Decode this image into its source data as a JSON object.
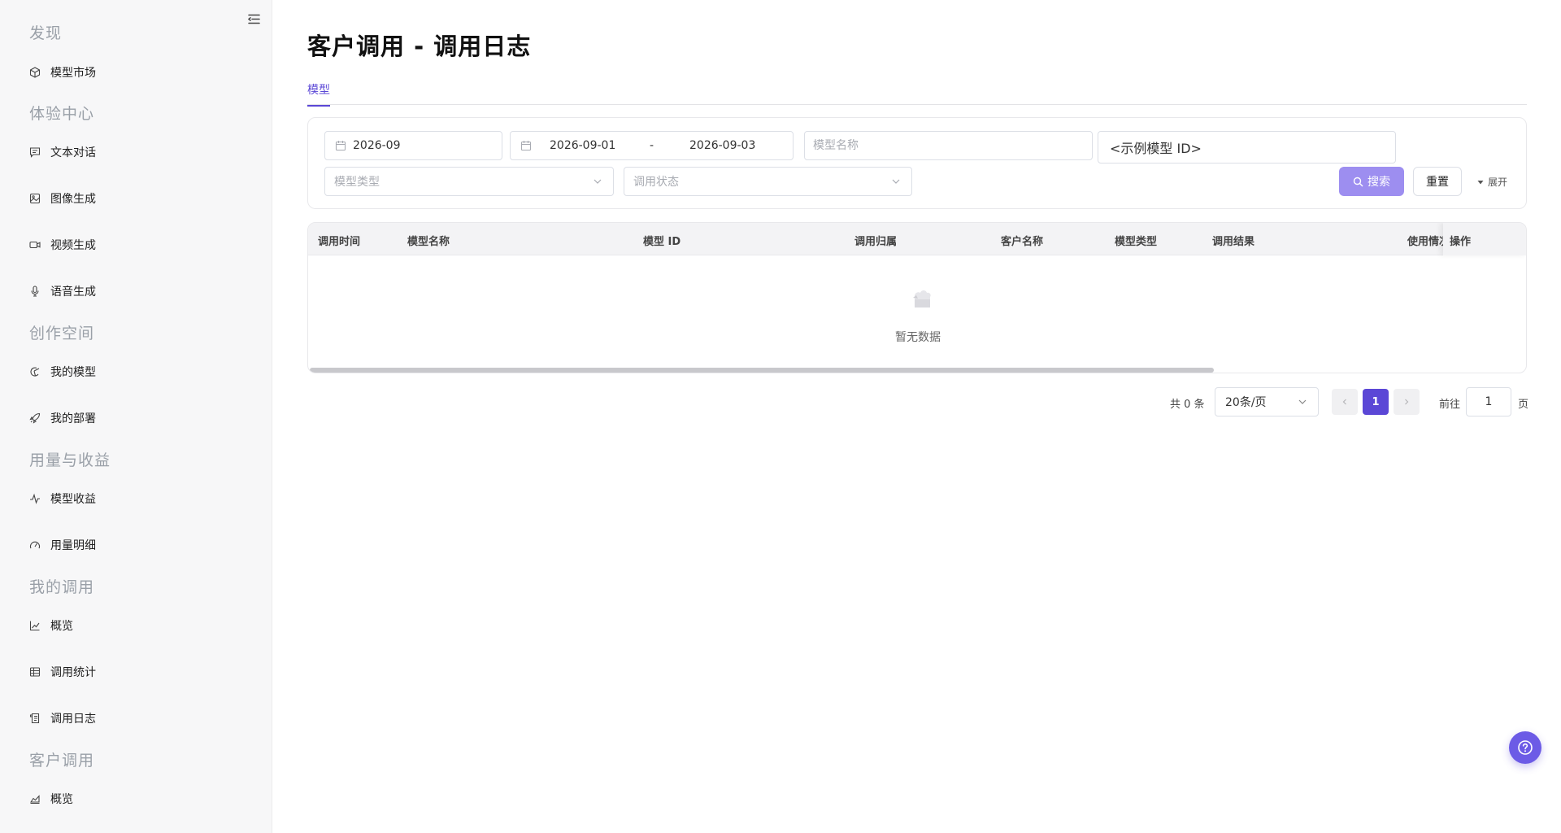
{
  "sidebar": {
    "sections": [
      {
        "title": "发现",
        "items": [
          {
            "label": "模型市场",
            "icon": "cube-icon"
          }
        ]
      },
      {
        "title": "体验中心",
        "items": [
          {
            "label": "文本对话",
            "icon": "chat-icon"
          },
          {
            "label": "图像生成",
            "icon": "image-icon"
          },
          {
            "label": "视频生成",
            "icon": "video-icon"
          },
          {
            "label": "语音生成",
            "icon": "mic-icon"
          }
        ]
      },
      {
        "title": "创作空间",
        "items": [
          {
            "label": "我的模型",
            "icon": "model-icon"
          },
          {
            "label": "我的部署",
            "icon": "rocket-icon"
          }
        ]
      },
      {
        "title": "用量与收益",
        "items": [
          {
            "label": "模型收益",
            "icon": "pulse-icon"
          },
          {
            "label": "用量明细",
            "icon": "gauge-icon"
          }
        ]
      },
      {
        "title": "我的调用",
        "items": [
          {
            "label": "概览",
            "icon": "line-chart-icon"
          },
          {
            "label": "调用统计",
            "icon": "table-icon"
          },
          {
            "label": "调用日志",
            "icon": "log-icon"
          }
        ]
      },
      {
        "title": "客户调用",
        "items": [
          {
            "label": "概览",
            "icon": "area-chart-icon"
          }
        ]
      }
    ]
  },
  "page": {
    "title": "客户调用 - 调用日志",
    "tabs": [
      {
        "label": "模型",
        "active": true
      }
    ]
  },
  "filters": {
    "month": "2026-09",
    "date_start": "2026-09-01",
    "date_sep": "-",
    "date_end": "2026-09-03",
    "model_name_placeholder": "模型名称",
    "model_id_value": "<示例模型 ID>",
    "model_type_placeholder": "模型类型",
    "call_status_placeholder": "调用状态",
    "search_label": "搜索",
    "reset_label": "重置",
    "expand_label": "展开"
  },
  "table": {
    "columns": [
      "调用时间",
      "模型名称",
      "模型 ID",
      "调用归属",
      "客户名称",
      "模型类型",
      "调用结果",
      "使用情况",
      "操作"
    ],
    "rows": [],
    "empty_text": "暂无数据"
  },
  "pagination": {
    "total_text": "共 0 条",
    "page_size": "20条/页",
    "current_page": "1",
    "goto_label": "前往",
    "goto_value": "1",
    "goto_suffix": "页"
  },
  "colors": {
    "accent": "#5b47d6",
    "search_button": "#9d8ef0",
    "help_button": "#6c5be6"
  }
}
